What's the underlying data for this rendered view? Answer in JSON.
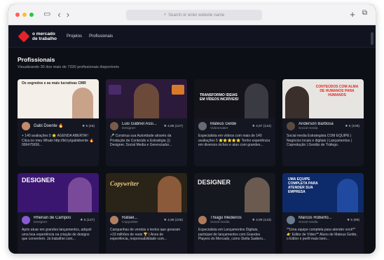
{
  "browser": {
    "address_placeholder": "Search or enter website name"
  },
  "nav": {
    "logo_line1": "o mercado",
    "logo_line2": "de trabalho",
    "links": [
      "Projetos",
      "Profissionais"
    ]
  },
  "page": {
    "title": "Profissionais",
    "subtitle": "Visualizando 30 dos mais de 7330 profissionais disponíveis"
  },
  "cards": [
    {
      "name": "Gabi Doente 🔥",
      "role": "",
      "rating": "★ 5 (46)",
      "banner_text": "Os segredos e as mais lucrativas CMR",
      "banner_bg": "#f4efe9",
      "banner_fg": "#222222",
      "avatar": "#c48a6a",
      "desc": "+ 140 avaliações 5 ⭐ AGENDA ABERTA!! Clica no meu Whats http://bit.ly/gabidoente 🔥 999475656..."
    },
    {
      "name": "Luis Gabriel Assi...",
      "role": "Designer",
      "rating": "★ 4,96 (127)",
      "banner_text": "",
      "banner_bg": "#2b1a3a",
      "banner_fg": "#ffffff",
      "avatar": "#7a5a4a",
      "desc": "🎤 Construa sua Autoridade através da Produção de Conteúdo e Estratégia 🎥 Designer, Social Media e Gerenciador..."
    },
    {
      "name": "Mateus Gelde",
      "role": "Videomaker",
      "rating": "★ 4,97 (134)",
      "banner_text": "TRANSFORMO IDEIAS EM VÍDEOS INCRÍVEIS!",
      "banner_bg": "#14131a",
      "banner_fg": "#ffffff",
      "avatar": "#6a6a72",
      "desc": "Especialista em vídeos com mais de 140 avaliações 5 ⭐⭐⭐⭐⭐ Tenho experiência em diversos nichos e atuo com grandes..."
    },
    {
      "name": "Anderson Barbosa",
      "role": "Social media",
      "rating": "★ 5 (109)",
      "banner_text": "CONTEÚDOS COM ALMA DE HUMANOS PARA HUMANOS",
      "banner_bg": "#e7e5e2",
      "banner_fg": "#e0271f",
      "avatar": "#5a4a40",
      "desc": "Social media Estrategista COM EQUIPE | Negócios locais e digitais | Lançamentos | Copredução | Gestão de Tráfego."
    },
    {
      "name": "Rhenan de Campos",
      "role": "Designer",
      "rating": "★ 5 (137)",
      "banner_text": "DESIGNER",
      "banner_bg": "#3a1670",
      "banner_fg": "#ffffff",
      "avatar": "#8a5ad0",
      "desc": "Após atuar em grandes lançamentos, adquiri uma boa experiência na criação de designs que convertem. Já trabalhei com..."
    },
    {
      "name": "Rafael...",
      "role": "Copywriter",
      "rating": "★ 4,98 (105)",
      "banner_text": "Copywriter",
      "banner_bg": "#2a2318",
      "banner_fg": "#e8c980",
      "avatar": "#b08060",
      "desc": "Campanhas de vendas e textos que geraram +10 milhões de reais 🏆 | Anos de experiência, responsabilidade com..."
    },
    {
      "name": "Thiago Medeiros",
      "role": "Social media",
      "rating": "★ 4,99 (133)",
      "banner_text": "DESIGNER",
      "banner_bg": "#15181f",
      "banner_fg": "#f2f2f2",
      "avatar": "#b07a5a",
      "desc": "Especialista em Lançamentos Digitais, participei de lançamentos com Grandes Players do Mercado, como Stella Sadeiro..."
    },
    {
      "name": "Marcos Roberto...",
      "role": "Social media",
      "rating": "★ 5 (99)",
      "banner_text": "UMA EQUIPE COMPLETA PARA ATENDER SUA EMPRESA",
      "banner_bg": "#0d2a6a",
      "banner_fg": "#ffffff",
      "avatar": "#6a7a90",
      "desc": "**Uma equipe completa para atender você** 👉 Editor de Vídeo** Aluno de Mateus Gelde, o Editor e perfil mais bem..."
    }
  ]
}
